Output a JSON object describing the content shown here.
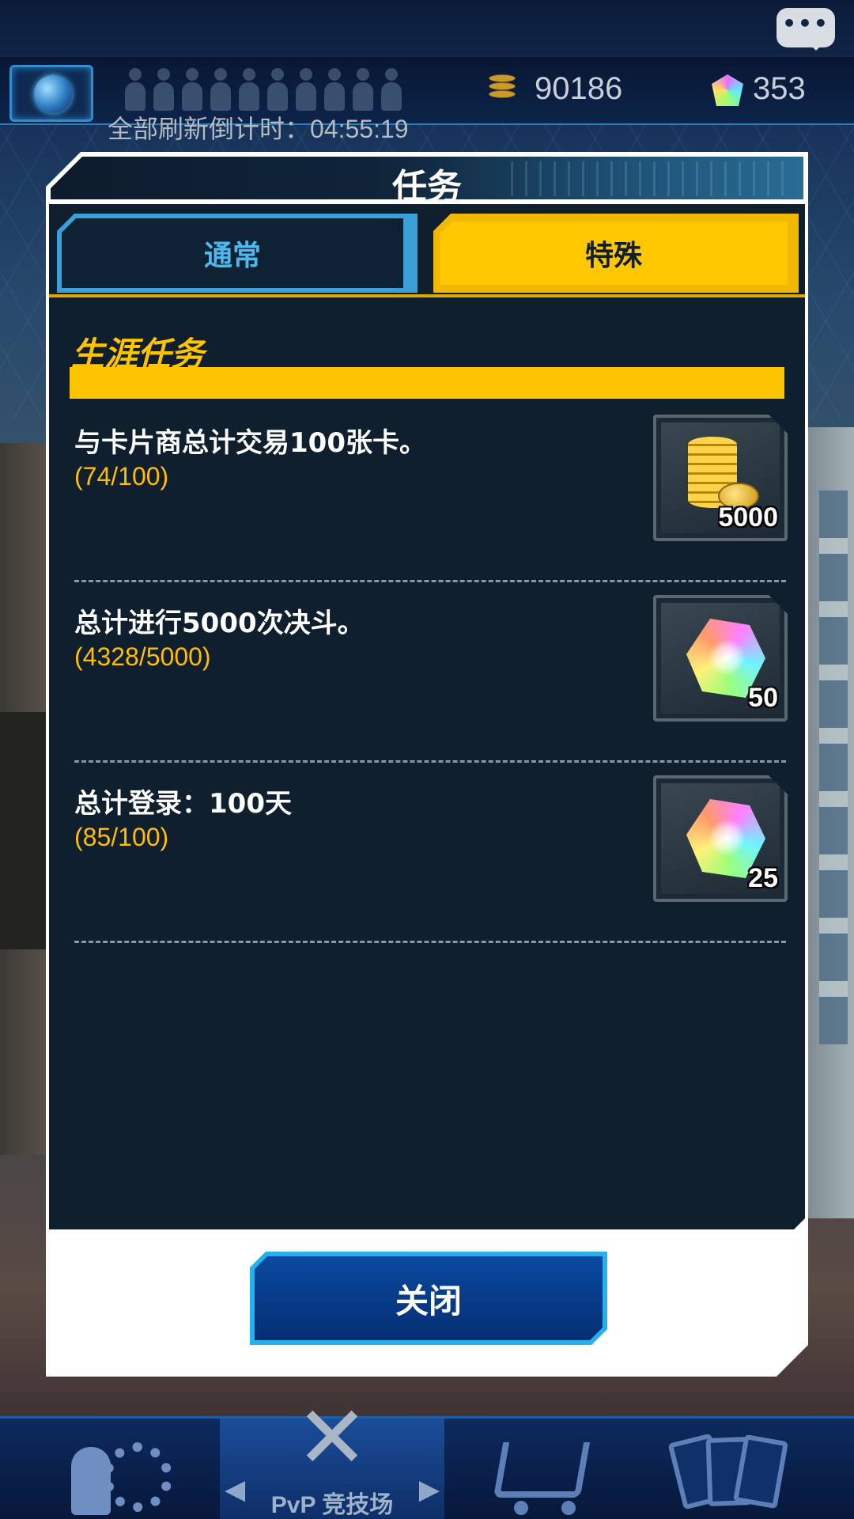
{
  "hud": {
    "gold": "90186",
    "gems": "353",
    "countdown": "全部刷新倒计时：04:55:19",
    "chat_dots": "•••"
  },
  "dialog": {
    "title": "任务",
    "tabs": [
      {
        "label": "通常",
        "active": false
      },
      {
        "label": "特殊",
        "active": true
      }
    ],
    "section_title": "生涯任务",
    "missions": [
      {
        "text": "与卡片商总计交易100张卡。",
        "progress": "(74/100)",
        "reward_type": "gold-coins",
        "reward_qty": "5000"
      },
      {
        "text": "总计进行5000次决斗。",
        "progress": "(4328/5000)",
        "reward_type": "gems",
        "reward_qty": "50"
      },
      {
        "text": "总计登录：100天",
        "progress": "(85/100)",
        "reward_type": "gems",
        "reward_qty": "25"
      }
    ],
    "close_label": "关闭"
  },
  "bottom_nav": {
    "pvp_label": "PvP 竞技场",
    "arrow_left": "◀",
    "arrow_right": "▶"
  },
  "colors": {
    "accent_yellow": "#ffc400",
    "tab_blue": "#3ca0d8",
    "panel_dark": "#0f1f2e",
    "close_button": "#0a4aa0"
  }
}
